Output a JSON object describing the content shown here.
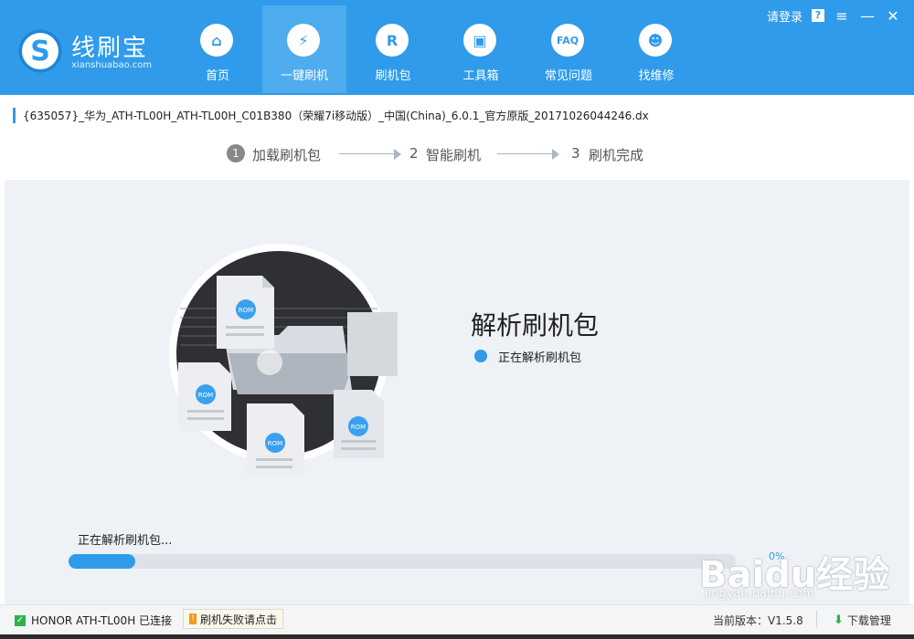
{
  "colors": {
    "brand": "#2f9bea",
    "header_active": "#4eacef",
    "panel_bg": "#eef1f5",
    "success": "#2fb24b",
    "warning": "#f29a1a"
  },
  "header": {
    "logo_title": "线刷宝",
    "logo_subtitle": "xianshuabao.com",
    "logo_icon": "S",
    "login_label": "请登录",
    "help_icon": "?",
    "nav": [
      {
        "label": "首页",
        "icon": "home-icon",
        "glyph": "⌂",
        "active": false
      },
      {
        "label": "一键刷机",
        "icon": "lightning-icon",
        "glyph": "⚡",
        "active": true
      },
      {
        "label": "刷机包",
        "icon": "rom-package-icon",
        "glyph": "R",
        "active": false
      },
      {
        "label": "工具箱",
        "icon": "toolbox-icon",
        "glyph": "▣",
        "active": false
      },
      {
        "label": "常见问题",
        "icon": "faq-icon",
        "glyph": "FAQ",
        "active": false
      },
      {
        "label": "找维修",
        "icon": "repair-person-icon",
        "glyph": "☻",
        "active": false
      }
    ]
  },
  "file": {
    "name": "{635057}_华为_ATH-TL00H_ATH-TL00H_C01B380（荣耀7i移动版）_中国(China)_6.0.1_官方原版_20171026044246.dx"
  },
  "steps": [
    {
      "num": "1",
      "label": "加载刷机包",
      "active": true
    },
    {
      "num": "2",
      "label": "智能刷机",
      "active": false
    },
    {
      "num": "3",
      "label": "刷机完成",
      "active": false
    }
  ],
  "status": {
    "title": "解析刷机包",
    "detail": "正在解析刷机包"
  },
  "illustration": {
    "doc_label": "ROM"
  },
  "progress": {
    "text": "正在解析刷机包...",
    "value_fraction": 0.1,
    "percent_label": "0%"
  },
  "watermark": {
    "main": "Baidu经验",
    "sub": "jingyan.baidu.com"
  },
  "statusbar": {
    "device": "HONOR ATH-TL00H 已连接",
    "fail_help": "刷机失败请点击",
    "version": "当前版本：V1.5.8",
    "download": "下载管理"
  }
}
